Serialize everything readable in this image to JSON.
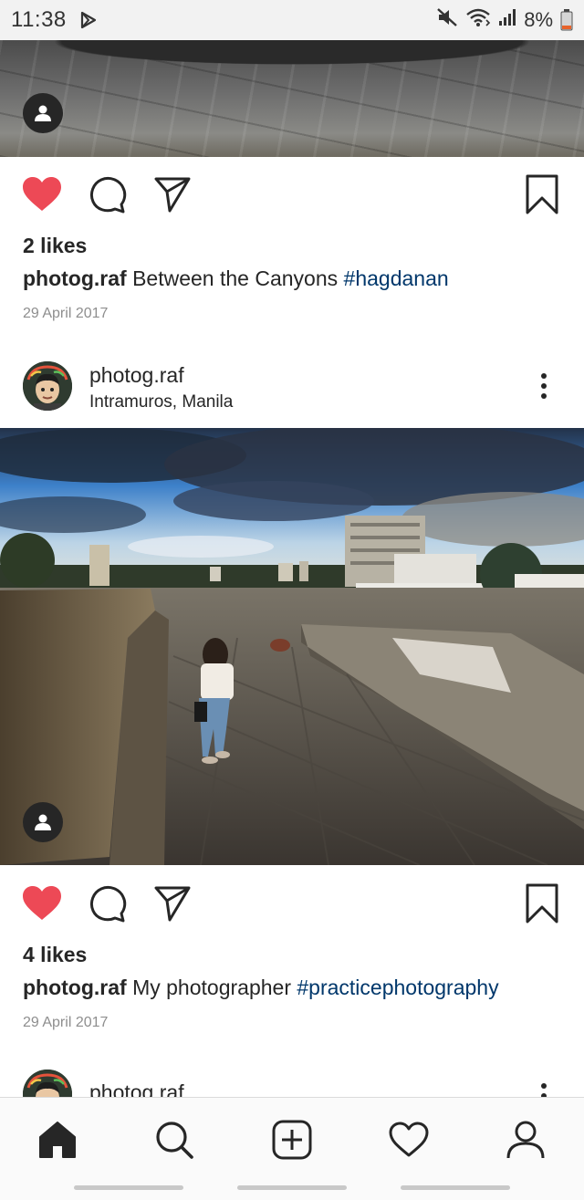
{
  "status_bar": {
    "time": "11:38",
    "battery": "8%",
    "icons": [
      "play-icon",
      "mute-icon",
      "wifi-icon",
      "signal-icon",
      "battery-icon"
    ]
  },
  "posts": [
    {
      "likes": "2 likes",
      "caption_user": "photog.raf",
      "caption_text": "Between the Canyons",
      "hashtag": "#hagdanan",
      "date": "29 April 2017",
      "liked": true
    },
    {
      "username": "photog.raf",
      "location": "Intramuros, Manila",
      "likes": "4 likes",
      "caption_user": "photog.raf",
      "caption_text": "My photographer",
      "hashtag": "#practicephotography",
      "date": "29 April 2017",
      "liked": true
    },
    {
      "username": "photog.raf"
    }
  ],
  "bottom_nav": {
    "items": [
      "home-icon",
      "search-icon",
      "new-post-icon",
      "activity-icon",
      "profile-icon"
    ]
  },
  "colors": {
    "like_red": "#ed4956",
    "hashtag_blue": "#00376b",
    "text": "#262626",
    "date_gray": "#8e8e8e"
  }
}
